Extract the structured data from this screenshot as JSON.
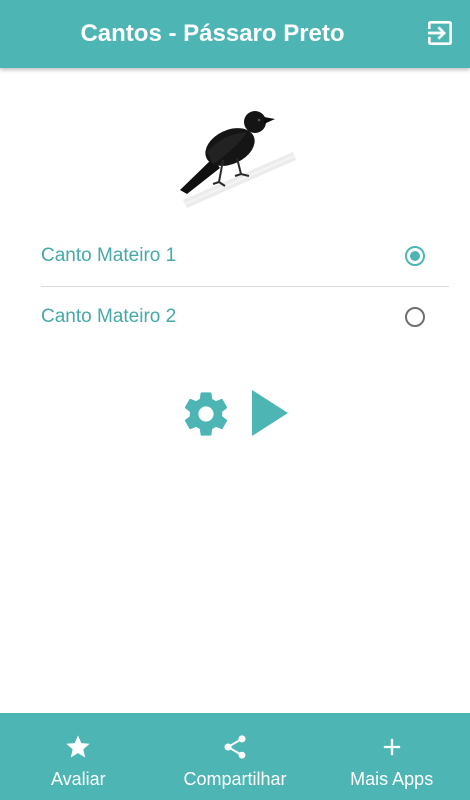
{
  "header": {
    "title": "Cantos - Pássaro Preto",
    "exit_icon": "exit-to-app-icon"
  },
  "options": [
    {
      "label": "Canto Mateiro 1",
      "selected": true
    },
    {
      "label": "Canto Mateiro 2",
      "selected": false
    }
  ],
  "controls": {
    "settings_icon": "gear-icon",
    "play_icon": "play-icon"
  },
  "bottom_nav": {
    "items": [
      {
        "label": "Avaliar",
        "icon": "star-icon"
      },
      {
        "label": "Compartilhar",
        "icon": "share-icon"
      },
      {
        "label": "Mais Apps",
        "icon": "plus-icon"
      }
    ]
  },
  "colors": {
    "accent": "#4db6b4",
    "label_text": "#45a9a7",
    "radio_unchecked": "#6f6f6f",
    "divider": "#dcdcdc"
  }
}
